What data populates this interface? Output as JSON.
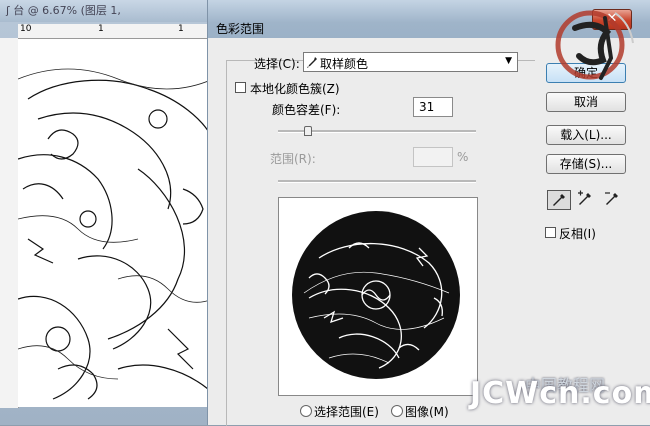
{
  "background_window": {
    "title": "ʃ 台 @ 6.67% (图层 1,",
    "ruler_marks": [
      "10",
      "1",
      "1"
    ]
  },
  "dialog": {
    "title": "色彩范围",
    "select_label": "选择(C):",
    "select_value": "取样颜色",
    "localized_clusters_label": "本地化颜色簇(Z)",
    "fuzziness_label": "颜色容差(F):",
    "fuzziness_value": "31",
    "fuzziness_level": 0.15,
    "range_label": "范围(R):",
    "range_value": "",
    "range_unit": "%",
    "ok_label": "确定",
    "cancel_label": "取消",
    "load_label": "载入(L)...",
    "save_label": "存储(S)...",
    "invert_label": "反相(I)",
    "radio_selection_label": "选择范围(E)",
    "radio_image_label": "图像(M)",
    "tools": [
      "eyedropper-icon",
      "eyedropper-plus-icon",
      "eyedropper-minus-icon"
    ]
  },
  "watermark": {
    "text": "JCWcn.com",
    "cn_text": "中国教程网"
  },
  "colors": {
    "accent_blue": "#3c7fb1",
    "close_red": "#c8452c",
    "title_blue": "#9fb4c9"
  }
}
